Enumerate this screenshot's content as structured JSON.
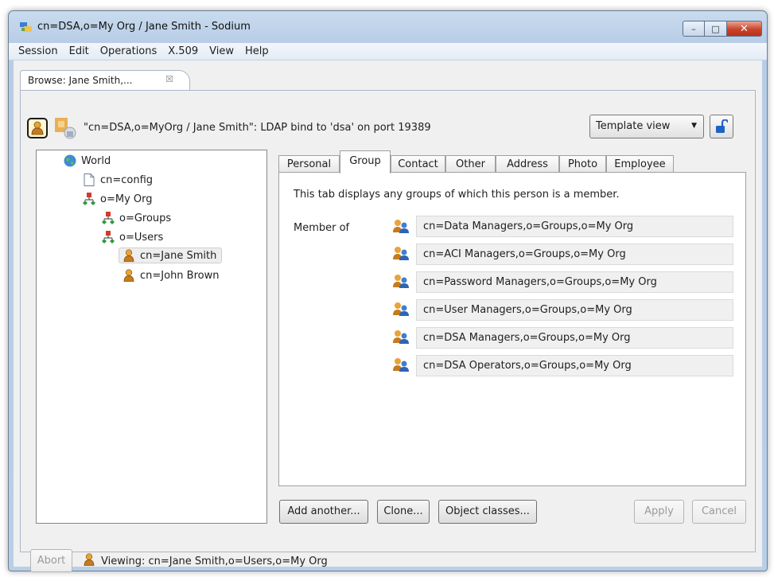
{
  "window": {
    "title": "cn=DSA,o=My Org / Jane Smith - Sodium",
    "buttons": {
      "minimize": "–",
      "maximize": "□",
      "close": "✕"
    }
  },
  "menu": [
    "Session",
    "Edit",
    "Operations",
    "X.509",
    "View",
    "Help"
  ],
  "editor_tab": {
    "label": "Browse: Jane Smith,...",
    "close": "☒"
  },
  "header": {
    "connection_text": "\"cn=DSA,o=MyOrg / Jane Smith\": LDAP bind to 'dsa' on port 19389",
    "view_select": {
      "selected": "Template view"
    }
  },
  "tree": [
    {
      "label": "World",
      "icon": "globe-icon"
    },
    {
      "label": "cn=config",
      "icon": "document-icon"
    },
    {
      "label": "o=My Org",
      "icon": "organization-icon"
    },
    {
      "label": "o=Groups",
      "icon": "organization-icon"
    },
    {
      "label": "o=Users",
      "icon": "organization-icon"
    },
    {
      "label": "cn=Jane Smith",
      "icon": "person-icon",
      "selected": true
    },
    {
      "label": "cn=John Brown",
      "icon": "person-icon"
    }
  ],
  "tabs": [
    {
      "label": "Personal"
    },
    {
      "label": "Group",
      "active": true
    },
    {
      "label": "Contact"
    },
    {
      "label": "Other"
    },
    {
      "label": "Address"
    },
    {
      "label": "Photo"
    },
    {
      "label": "Employee"
    }
  ],
  "group_tab": {
    "description": "This tab displays any groups of which this person is a member.",
    "member_label": "Member of",
    "groups": [
      "cn=Data Managers,o=Groups,o=My Org",
      "cn=ACI Managers,o=Groups,o=My Org",
      "cn=Password Managers,o=Groups,o=My Org",
      "cn=User Managers,o=Groups,o=My Org",
      "cn=DSA Managers,o=Groups,o=My Org",
      "cn=DSA Operators,o=Groups,o=My Org"
    ]
  },
  "buttons": {
    "add_another": "Add another...",
    "clone": "Clone...",
    "object_classes": "Object classes...",
    "apply": "Apply",
    "cancel": "Cancel"
  },
  "status": {
    "abort": "Abort",
    "text": "Viewing: cn=Jane Smith,o=Users,o=My Org"
  },
  "colors": {
    "accent": "#1e63c4",
    "person_orange": "#e8a33a",
    "org_red": "#d23a2a",
    "org_green": "#2e9a3e"
  }
}
